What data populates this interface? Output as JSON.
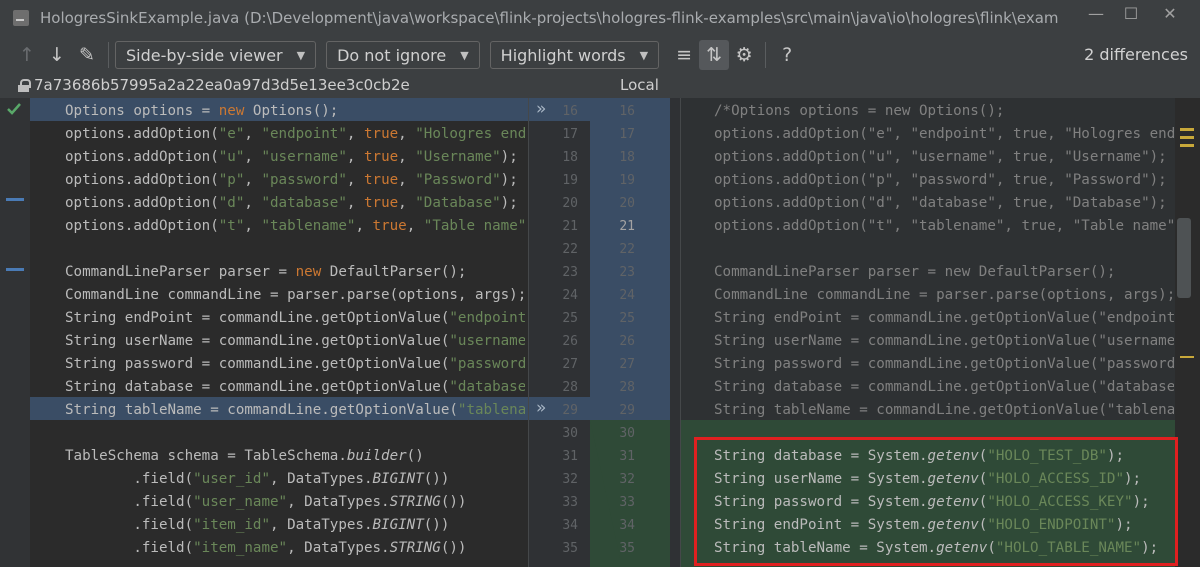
{
  "window": {
    "title": "HologresSinkExample.java (D:\\Development\\java\\workspace\\flink-projects\\hologres-flink-examples\\src\\main\\java\\io\\hologres\\flink\\exam",
    "controls": [
      "minimize-icon",
      "maximize-icon",
      "close-icon"
    ]
  },
  "toolbar": {
    "viewer_mode": "Side-by-side viewer",
    "whitespace_mode": "Do not ignore",
    "highlight_mode": "Highlight words",
    "help_label": "?",
    "differences_label": "2 differences",
    "icons": [
      "prev-diff-icon",
      "next-diff-icon",
      "edit-icon",
      "collapse-unchanged-icon",
      "sync-scroll-icon",
      "settings-icon"
    ]
  },
  "revisions": {
    "left_hash": "7a73686b57995a2a22ea0a97d3d5e13ee3c0cb2e",
    "right_label": "Local"
  },
  "colors": {
    "modified_bg": "#3a4d65",
    "inserted_bg": "#2f4a37",
    "keyword": "#cc7832",
    "string": "#6a8759",
    "highlight_box": "#e02020"
  },
  "left_numbers": [
    "16",
    "17",
    "18",
    "19",
    "20",
    "21",
    "22",
    "23",
    "24",
    "25",
    "26",
    "27",
    "28",
    "29",
    "30",
    "31",
    "32",
    "33",
    "34",
    "35"
  ],
  "right_numbers": [
    "16",
    "17",
    "18",
    "19",
    "20",
    "21",
    "22",
    "23",
    "24",
    "25",
    "26",
    "27",
    "28",
    "29",
    "30",
    "31",
    "32",
    "33",
    "34",
    "35"
  ],
  "left_lines": [
    "Options options = new Options();",
    "options.addOption(\"e\", \"endpoint\", true, \"Hologres endpoint\");",
    "options.addOption(\"u\", \"username\", true, \"Username\");",
    "options.addOption(\"p\", \"password\", true, \"Password\");",
    "options.addOption(\"d\", \"database\", true, \"Database\");",
    "options.addOption(\"t\", \"tablename\", true, \"Table name\");",
    "",
    "CommandLineParser parser = new DefaultParser();",
    "CommandLine commandLine = parser.parse(options, args);",
    "String endPoint = commandLine.getOptionValue(\"endpoint\");",
    "String userName = commandLine.getOptionValue(\"username\");",
    "String password = commandLine.getOptionValue(\"password\");",
    "String database = commandLine.getOptionValue(\"database\");",
    "String tableName = commandLine.getOptionValue(\"tablename\");",
    "",
    "TableSchema schema = TableSchema.builder()",
    "        .field(\"user_id\", DataTypes.BIGINT())",
    "        .field(\"user_name\", DataTypes.STRING())",
    "        .field(\"item_id\", DataTypes.BIGINT())",
    "        .field(\"item_name\", DataTypes.STRING())"
  ],
  "right_lines": [
    "/*Options options = new Options();",
    "options.addOption(\"e\", \"endpoint\", true, \"Hologres endpoint\");",
    "options.addOption(\"u\", \"username\", true, \"Username\");",
    "options.addOption(\"p\", \"password\", true, \"Password\");",
    "options.addOption(\"d\", \"database\", true, \"Database\");",
    "options.addOption(\"t\", \"tablename\", true, \"Table name\");",
    "",
    "CommandLineParser parser = new DefaultParser();",
    "CommandLine commandLine = parser.parse(options, args);",
    "String endPoint = commandLine.getOptionValue(\"endpoint\");",
    "String userName = commandLine.getOptionValue(\"username\");",
    "String password = commandLine.getOptionValue(\"password\");",
    "String database = commandLine.getOptionValue(\"database\");",
    "String tableName = commandLine.getOptionValue(\"tablename\");",
    "",
    "String database = System.getenv(\"HOLO_TEST_DB\");",
    "String userName = System.getenv(\"HOLO_ACCESS_ID\");",
    "String password = System.getenv(\"HOLO_ACCESS_KEY\");",
    "String endPoint = System.getenv(\"HOLO_ENDPOINT\");",
    "String tableName = System.getenv(\"HOLO_TABLE_NAME\");"
  ]
}
